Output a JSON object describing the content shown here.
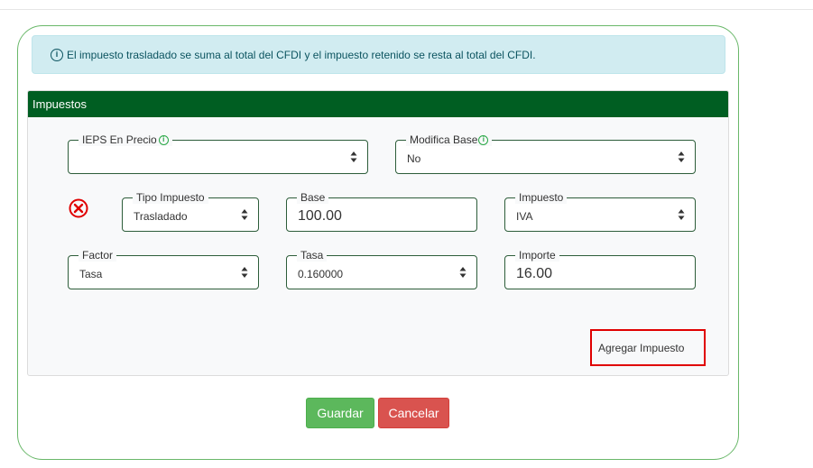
{
  "alert": {
    "icon": "info-circle-icon",
    "text": "El impuesto trasladado se suma al total del CFDI y el impuesto retenido se resta al total del CFDI."
  },
  "panel": {
    "title": "Impuestos",
    "header_color": "#005e22"
  },
  "ieps_precio": {
    "label": "IEPS En Precio",
    "value": ""
  },
  "modifica_base": {
    "label": "Modifica Base",
    "value": "No"
  },
  "tipo_impuesto": {
    "label": "Tipo Impuesto",
    "value": "Trasladado"
  },
  "base": {
    "label": "Base",
    "value": "100.00"
  },
  "impuesto": {
    "label": "Impuesto",
    "value": "IVA"
  },
  "factor": {
    "label": "Factor",
    "value": "Tasa"
  },
  "tasa": {
    "label": "Tasa",
    "value": "0.160000"
  },
  "importe": {
    "label": "Importe",
    "value": "16.00"
  },
  "buttons": {
    "add_tax": "Agregar Impuesto",
    "save": "Guardar",
    "cancel": "Cancelar"
  },
  "colors": {
    "save": "#5cb85c",
    "cancel": "#d9534f",
    "remove_icon": "#e00000",
    "highlight_border": "#e00000"
  }
}
